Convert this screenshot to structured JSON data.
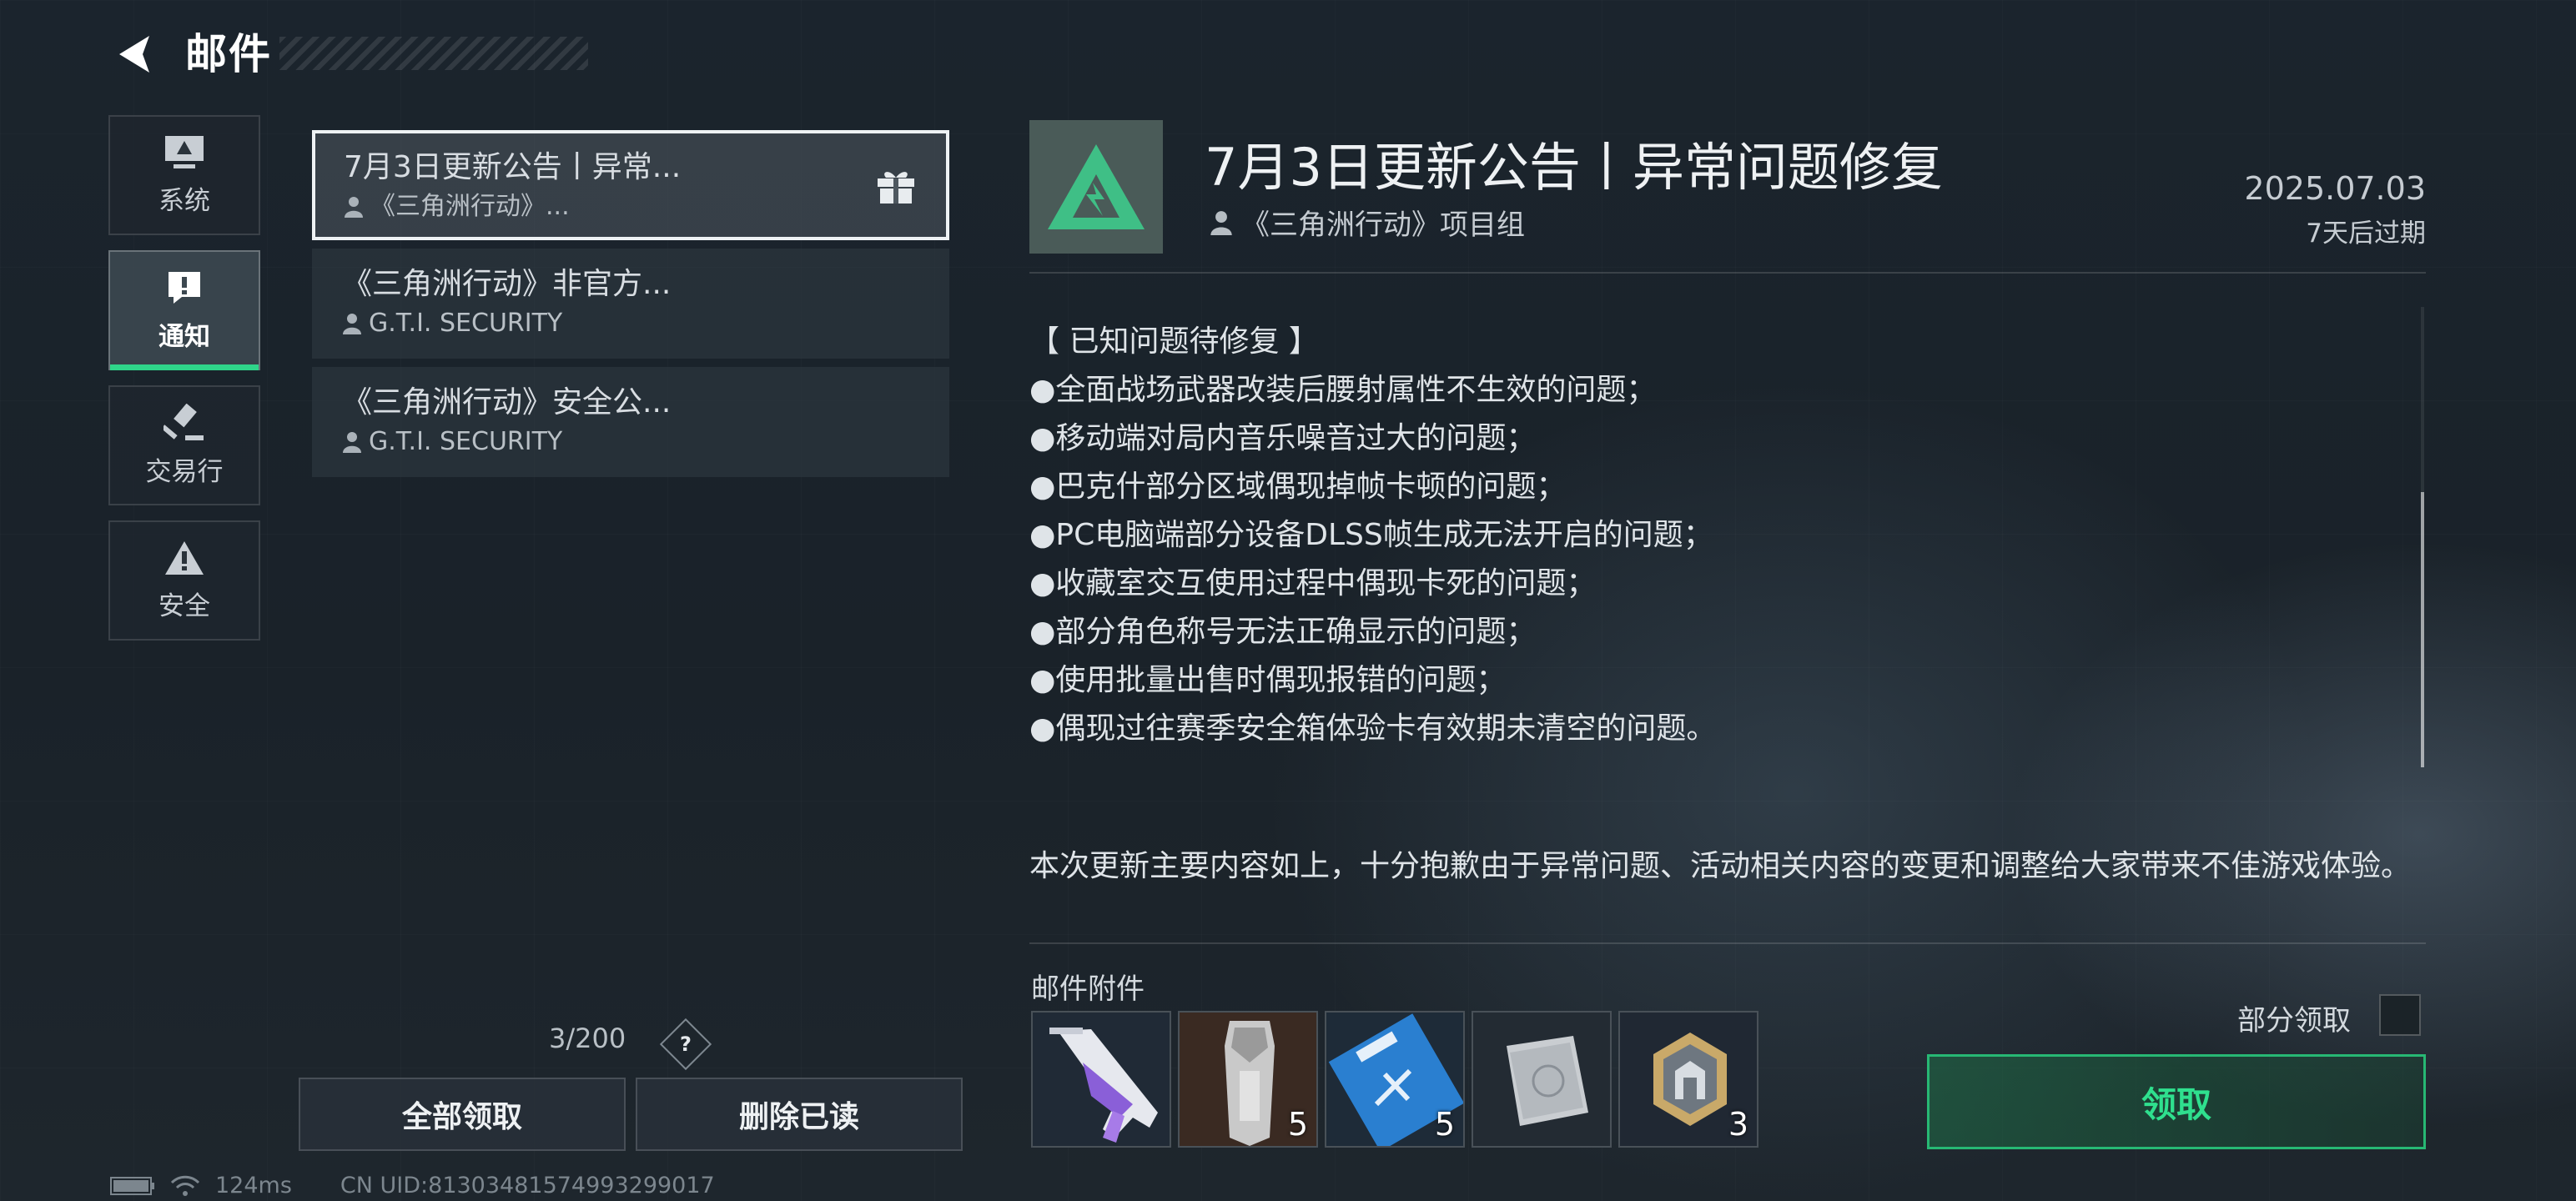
{
  "header": {
    "title": "邮件"
  },
  "categories": [
    {
      "label": "系统",
      "icon": "monitor-icon"
    },
    {
      "label": "通知",
      "icon": "exclamation-icon",
      "active": true
    },
    {
      "label": "交易行",
      "icon": "gavel-icon"
    },
    {
      "label": "安全",
      "icon": "warning-icon"
    }
  ],
  "mail_list": [
    {
      "title": "7月3日更新公告丨异常...",
      "sender": "《三角洲行动》...",
      "has_gift": true,
      "selected": true
    },
    {
      "title": "《三角洲行动》非官方...",
      "sender": "G.T.I. SECURITY"
    },
    {
      "title": "《三角洲行动》安全公...",
      "sender": "G.T.I. SECURITY"
    }
  ],
  "list_footer": {
    "count": "3/200",
    "help": "?",
    "claim_all": "全部领取",
    "delete_read": "删除已读"
  },
  "status": {
    "ping": "124ms",
    "uid": "CN UID:81303481574993299017"
  },
  "detail": {
    "title": "7月3日更新公告丨异常问题修复",
    "sender": "《三角洲行动》项目组",
    "date": "2025.07.03",
    "expire": "7天后过期",
    "section_heading": "【 已知问题待修复 】",
    "issues": [
      "●全面战场武器改装后腰射属性不生效的问题；",
      "●移动端对局内音乐噪音过大的问题；",
      "●巴克什部分区域偶现掉帧卡顿的问题；",
      "●PC电脑端部分设备DLSS帧生成无法开启的问题；",
      "●收藏室交互使用过程中偶现卡死的问题；",
      "●部分角色称号无法正确显示的问题；",
      "●使用批量出售时偶现报错的问题；",
      "●偶现过往赛季安全箱体验卡有效期未清空的问题。"
    ],
    "closing": "本次更新主要内容如上，十分抱歉由于异常问题、活动相关内容的变更和调整给大家带来不佳游戏体验。"
  },
  "attachments": {
    "label": "邮件附件",
    "items": [
      {
        "name": "weapon-skin",
        "count": ""
      },
      {
        "name": "card-pack",
        "count": "5"
      },
      {
        "name": "ticket",
        "count": "5"
      },
      {
        "name": "document",
        "count": ""
      },
      {
        "name": "badge",
        "count": "3"
      }
    ],
    "partial_label": "部分领取",
    "claim_label": "领取"
  },
  "colors": {
    "accent": "#2fd68a",
    "claim_text": "#2fe08e"
  }
}
